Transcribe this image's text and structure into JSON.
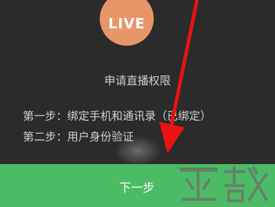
{
  "badge": {
    "label": "LIVE",
    "color": "#e8956a"
  },
  "title": "申请直播权限",
  "steps": [
    "第一步：绑定手机和通讯录（已绑定）",
    "第二步：用户身份验证"
  ],
  "next_button": {
    "label": "下一步",
    "color": "#4cbb65"
  },
  "annotation": {
    "arrow_color": "#ee1111"
  },
  "watermark": {
    "icon": "watermark-logo-icon"
  }
}
